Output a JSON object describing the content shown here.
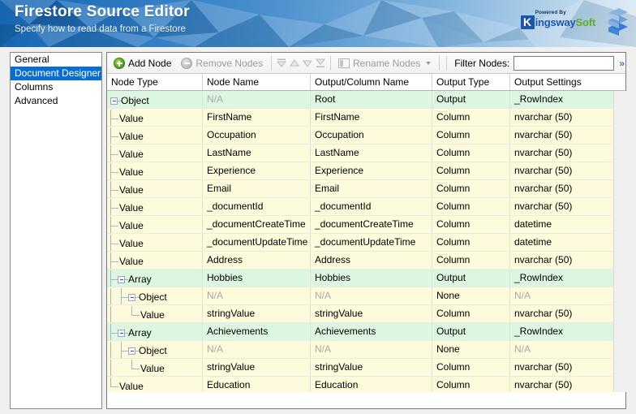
{
  "header": {
    "title": "Firestore Source Editor",
    "subtitle": "Specify how to read data from a Firestore",
    "logo": {
      "k": "K",
      "powered_by": "Powered By",
      "brand_first": "ingsway",
      "brand_second": "Soft",
      "brand_color": "#1e55a8",
      "accent_color": "#5aaf2a",
      "chevron_icon": "kingswaysoft-chevron-logo"
    },
    "banner_gradient_from": "#1565b0",
    "banner_gradient_to": "#dbe9f5"
  },
  "sidebar": {
    "items": [
      {
        "label": "General",
        "selected": false
      },
      {
        "label": "Document Designer",
        "selected": true
      },
      {
        "label": "Columns",
        "selected": false
      },
      {
        "label": "Advanced",
        "selected": false
      }
    ],
    "selected_color": "#0a6ed1"
  },
  "toolbar": {
    "add_node_label": "Add Node",
    "add_node_icon": "plus-circle-icon",
    "remove_nodes_label": "Remove Nodes",
    "remove_nodes_icon": "minus-circle-icon",
    "move_top_icon": "move-to-top-icon",
    "move_up_icon": "move-up-icon",
    "move_down_icon": "move-down-icon",
    "move_bottom_icon": "move-to-bottom-icon",
    "rename_nodes_label": "Rename Nodes",
    "rename_nodes_icon": "rename-icon",
    "rename_caret_icon": "chevron-down-icon",
    "filter_label": "Filter Nodes:",
    "filter_value": "",
    "filter_placeholder": "",
    "overflow_label": "»"
  },
  "grid": {
    "columns": [
      "Node Type",
      "Node Name",
      "Output/Column Name",
      "Output Type",
      "Output Settings"
    ],
    "rows": [
      {
        "depth": 0,
        "expander": true,
        "last": false,
        "type": "Object",
        "name": "N/A",
        "name_na": true,
        "output_name": "Root",
        "output_name_na": false,
        "output_type": "Output",
        "output_settings": "_RowIndex",
        "settings_na": false,
        "tone": "green"
      },
      {
        "depth": 1,
        "expander": false,
        "last": false,
        "type": "Value",
        "name": "FirstName",
        "name_na": false,
        "output_name": "FirstName",
        "output_name_na": false,
        "output_type": "Column",
        "output_settings": "nvarchar (50)",
        "settings_na": false,
        "tone": "yellow"
      },
      {
        "depth": 1,
        "expander": false,
        "last": false,
        "type": "Value",
        "name": "Occupation",
        "name_na": false,
        "output_name": "Occupation",
        "output_name_na": false,
        "output_type": "Column",
        "output_settings": "nvarchar (50)",
        "settings_na": false,
        "tone": "yellow"
      },
      {
        "depth": 1,
        "expander": false,
        "last": false,
        "type": "Value",
        "name": "LastName",
        "name_na": false,
        "output_name": "LastName",
        "output_name_na": false,
        "output_type": "Column",
        "output_settings": "nvarchar (50)",
        "settings_na": false,
        "tone": "yellow"
      },
      {
        "depth": 1,
        "expander": false,
        "last": false,
        "type": "Value",
        "name": "Experience",
        "name_na": false,
        "output_name": "Experience",
        "output_name_na": false,
        "output_type": "Column",
        "output_settings": "nvarchar (50)",
        "settings_na": false,
        "tone": "yellow"
      },
      {
        "depth": 1,
        "expander": false,
        "last": false,
        "type": "Value",
        "name": "Email",
        "name_na": false,
        "output_name": "Email",
        "output_name_na": false,
        "output_type": "Column",
        "output_settings": "nvarchar (50)",
        "settings_na": false,
        "tone": "yellow"
      },
      {
        "depth": 1,
        "expander": false,
        "last": false,
        "type": "Value",
        "name": "_documentId",
        "name_na": false,
        "output_name": "_documentId",
        "output_name_na": false,
        "output_type": "Column",
        "output_settings": "nvarchar (50)",
        "settings_na": false,
        "tone": "yellow"
      },
      {
        "depth": 1,
        "expander": false,
        "last": false,
        "type": "Value",
        "name": "_documentCreateTime",
        "name_na": false,
        "output_name": "_documentCreateTime",
        "output_name_na": false,
        "output_type": "Column",
        "output_settings": "datetime",
        "settings_na": false,
        "tone": "yellow"
      },
      {
        "depth": 1,
        "expander": false,
        "last": false,
        "type": "Value",
        "name": "_documentUpdateTime",
        "name_na": false,
        "output_name": "_documentUpdateTime",
        "output_name_na": false,
        "output_type": "Column",
        "output_settings": "datetime",
        "settings_na": false,
        "tone": "yellow"
      },
      {
        "depth": 1,
        "expander": false,
        "last": false,
        "type": "Value",
        "name": "Address",
        "name_na": false,
        "output_name": "Address",
        "output_name_na": false,
        "output_type": "Column",
        "output_settings": "nvarchar (50)",
        "settings_na": false,
        "tone": "yellow"
      },
      {
        "depth": 1,
        "expander": true,
        "last": false,
        "type": "Array",
        "name": "Hobbies",
        "name_na": false,
        "output_name": "Hobbies",
        "output_name_na": false,
        "output_type": "Output",
        "output_settings": "_RowIndex",
        "settings_na": false,
        "tone": "green"
      },
      {
        "depth": 2,
        "expander": true,
        "last": false,
        "type": "Object",
        "name": "N/A",
        "name_na": true,
        "output_name": "N/A",
        "output_name_na": true,
        "output_type": "None",
        "output_settings": "N/A",
        "settings_na": true,
        "tone": "yellow"
      },
      {
        "depth": 3,
        "expander": false,
        "last": true,
        "type": "Value",
        "name": "stringValue",
        "name_na": false,
        "output_name": "stringValue",
        "output_name_na": false,
        "output_type": "Column",
        "output_settings": "nvarchar (50)",
        "settings_na": false,
        "tone": "yellow"
      },
      {
        "depth": 1,
        "expander": true,
        "last": false,
        "type": "Array",
        "name": "Achievements",
        "name_na": false,
        "output_name": "Achievements",
        "output_name_na": false,
        "output_type": "Output",
        "output_settings": "_RowIndex",
        "settings_na": false,
        "tone": "green"
      },
      {
        "depth": 2,
        "expander": true,
        "last": false,
        "type": "Object",
        "name": "N/A",
        "name_na": true,
        "output_name": "N/A",
        "output_name_na": true,
        "output_type": "None",
        "output_settings": "N/A",
        "settings_na": true,
        "tone": "yellow"
      },
      {
        "depth": 3,
        "expander": false,
        "last": true,
        "type": "Value",
        "name": "stringValue",
        "name_na": false,
        "output_name": "stringValue",
        "output_name_na": false,
        "output_type": "Column",
        "output_settings": "nvarchar (50)",
        "settings_na": false,
        "tone": "yellow"
      },
      {
        "depth": 1,
        "expander": false,
        "last": true,
        "type": "Value",
        "name": "Education",
        "name_na": false,
        "output_name": "Education",
        "output_name_na": false,
        "output_type": "Column",
        "output_settings": "nvarchar (50)",
        "settings_na": false,
        "tone": "yellow"
      }
    ],
    "row_color_group": "#ddf6e2",
    "row_color_leaf": "#fdfbdc"
  }
}
